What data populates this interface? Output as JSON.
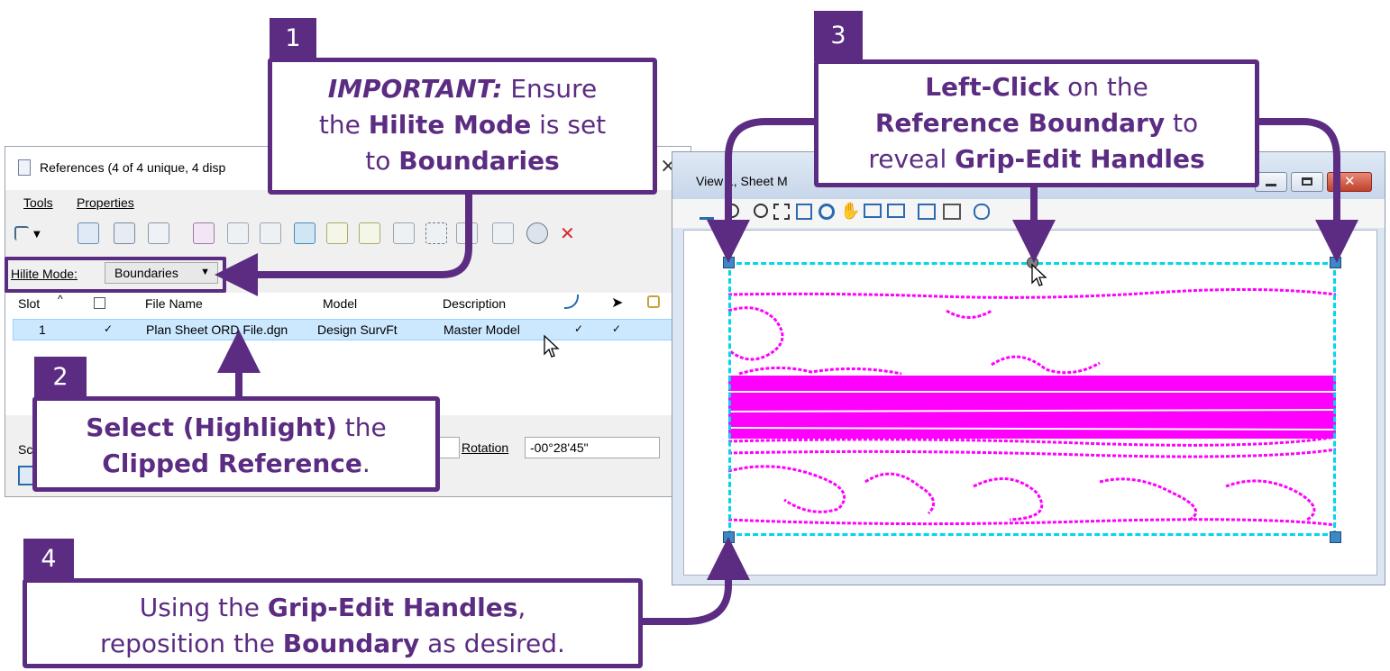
{
  "ref_dialog": {
    "title": "References (4 of 4 unique, 4 disp",
    "close_glyph": "×",
    "menu": {
      "tools": "Tools",
      "properties": "Properties"
    },
    "hilite_label": "Hilite Mode:",
    "hilite_value": "Boundaries",
    "columns": {
      "slot": "Slot",
      "file_name": "File Name",
      "model": "Model",
      "description": "Description"
    },
    "row": {
      "slot": "1",
      "display_check": "✓",
      "file_name": "Plan Sheet ORD File.dgn",
      "model": "Design SurvFt",
      "description": "Master Model",
      "snap_check": "✓",
      "locate_check": "✓"
    },
    "bottom_partial_label": "Sc",
    "rotation_label": "Rotation",
    "rotation_value": "-00°28'45\""
  },
  "view_window": {
    "title": "View 1, Sheet M"
  },
  "callouts": {
    "c1": {
      "number": "1",
      "line1_em": "IMPORTANT:",
      "line1_rest": " Ensure",
      "line2_pre": "the ",
      "line2_b": "Hilite Mode",
      "line2_post": " is set",
      "line3_pre": "to ",
      "line3_b": "Boundaries"
    },
    "c2": {
      "number": "2",
      "line1_b": "Select (Highlight)",
      "line1_post": " the",
      "line2_b": "Clipped Reference",
      "line2_post": "."
    },
    "c3": {
      "number": "3",
      "line1_b": "Left-Click",
      "line1_post": " on the",
      "line2_b": "Reference Boundary",
      "line2_post": " to",
      "line3_pre": "reveal ",
      "line3_b": "Grip-Edit Handles"
    },
    "c4": {
      "number": "4",
      "line1_pre": "Using the ",
      "line1_b": "Grip-Edit Handles",
      "line1_post": ",",
      "line2_pre": "reposition the ",
      "line2_b": "Boundary",
      "line2_post": " as desired."
    }
  },
  "colors": {
    "accent": "#5b2c82",
    "boundary": "#00d8e8",
    "graphics": "#ff00ff",
    "selection": "#cce8ff"
  },
  "icons": [
    "document-icon",
    "cursor-icon",
    "grip-handle-icon",
    "zoom-in-icon",
    "zoom-out-icon",
    "pan-icon",
    "window-minimize-icon",
    "window-maximize-icon",
    "window-close-icon"
  ]
}
